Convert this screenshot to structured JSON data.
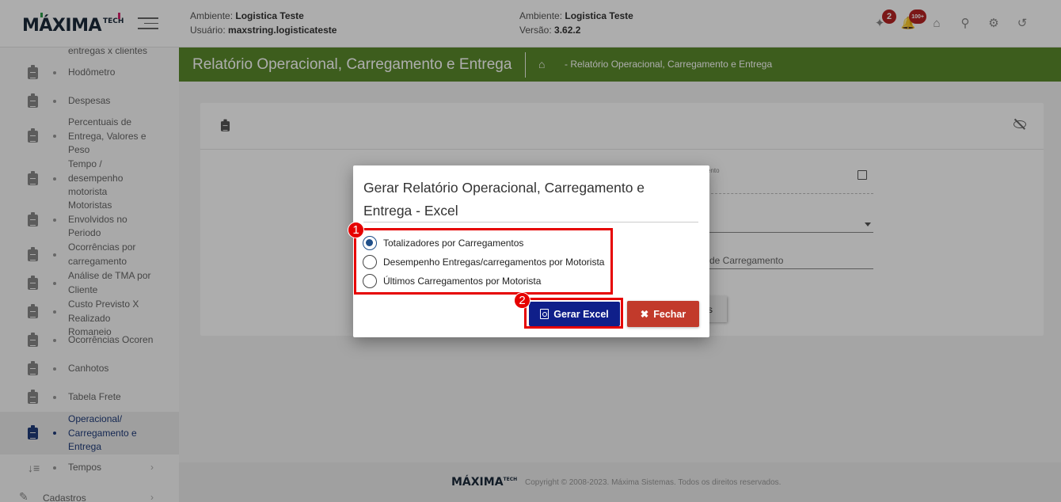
{
  "header": {
    "logo_text": "MÁXIMA",
    "logo_suffix": "TECH",
    "env_left": {
      "ambiente_label": "Ambiente:",
      "ambiente_value": "Logistica Teste",
      "usuario_label": "Usuário:",
      "usuario_value": "maxstring.logisticateste"
    },
    "env_right": {
      "ambiente_label": "Ambiente:",
      "ambiente_value": "Logistica Teste",
      "versao_label": "Versão:",
      "versao_value": "3.62.2"
    },
    "icons": [
      {
        "name": "courier-icon",
        "badge": "2"
      },
      {
        "name": "bell-icon",
        "badge": "100+"
      },
      {
        "name": "home-icon",
        "badge": ""
      },
      {
        "name": "wrench-icon",
        "badge": ""
      },
      {
        "name": "gear-icon",
        "badge": ""
      },
      {
        "name": "logout-icon",
        "badge": ""
      }
    ]
  },
  "sidebar": {
    "items": [
      {
        "label": "entregas x clientes",
        "active": false
      },
      {
        "label": "Hodômetro",
        "active": false
      },
      {
        "label": "Despesas",
        "active": false
      },
      {
        "label": "Percentuais de Entrega, Valores e Peso",
        "active": false
      },
      {
        "label": "Tempo / desempenho motorista",
        "active": false
      },
      {
        "label": "Motoristas Envolvidos no Periodo",
        "active": false
      },
      {
        "label": "Ocorrências por carregamento",
        "active": false
      },
      {
        "label": "Análise de TMA por Cliente",
        "active": false
      },
      {
        "label": "Custo Previsto X Realizado Romaneio",
        "active": false
      },
      {
        "label": "Ocorrências Ocoren",
        "active": false
      },
      {
        "label": "Canhotos",
        "active": false
      },
      {
        "label": "Tabela Frete",
        "active": false
      },
      {
        "label": "Operacional/ Carregamento e Entrega",
        "active": true
      },
      {
        "label": "Tempos",
        "active": false
      },
      {
        "label": "Cadastros",
        "active": false
      }
    ]
  },
  "page": {
    "title": "Relatório Operacional, Carregamento e Entrega",
    "breadcrumb": "- Relatório Operacional, Carregamento e Entrega"
  },
  "card": {
    "field1_label": "ento",
    "field3_text": "de Carregamento",
    "behind_button": "s"
  },
  "modal": {
    "title": "Gerar Relatório Operacional, Carregamento e Entrega - Excel",
    "options": [
      {
        "label": "Totalizadores por Carregamentos",
        "selected": true
      },
      {
        "label": "Desempenho Entregas/carregamentos por Motorista",
        "selected": false
      },
      {
        "label": "Últimos Carregamentos por Motorista",
        "selected": false
      }
    ],
    "generate_label": "Gerar Excel",
    "close_label": "Fechar",
    "annotations": [
      "1",
      "2"
    ]
  },
  "footer": {
    "logo_text": "MÁXIMA",
    "logo_suffix": "TECH",
    "copyright": "Copyright © 2008-2023. Máxima Sistemas. Todos os direitos reservados."
  },
  "colors": {
    "page_bar": "#5b8a2b",
    "generate_button": "#0f1f8a",
    "close_button": "#c23a2b",
    "annotation_red": "#e60000",
    "badge": "#b62323"
  }
}
